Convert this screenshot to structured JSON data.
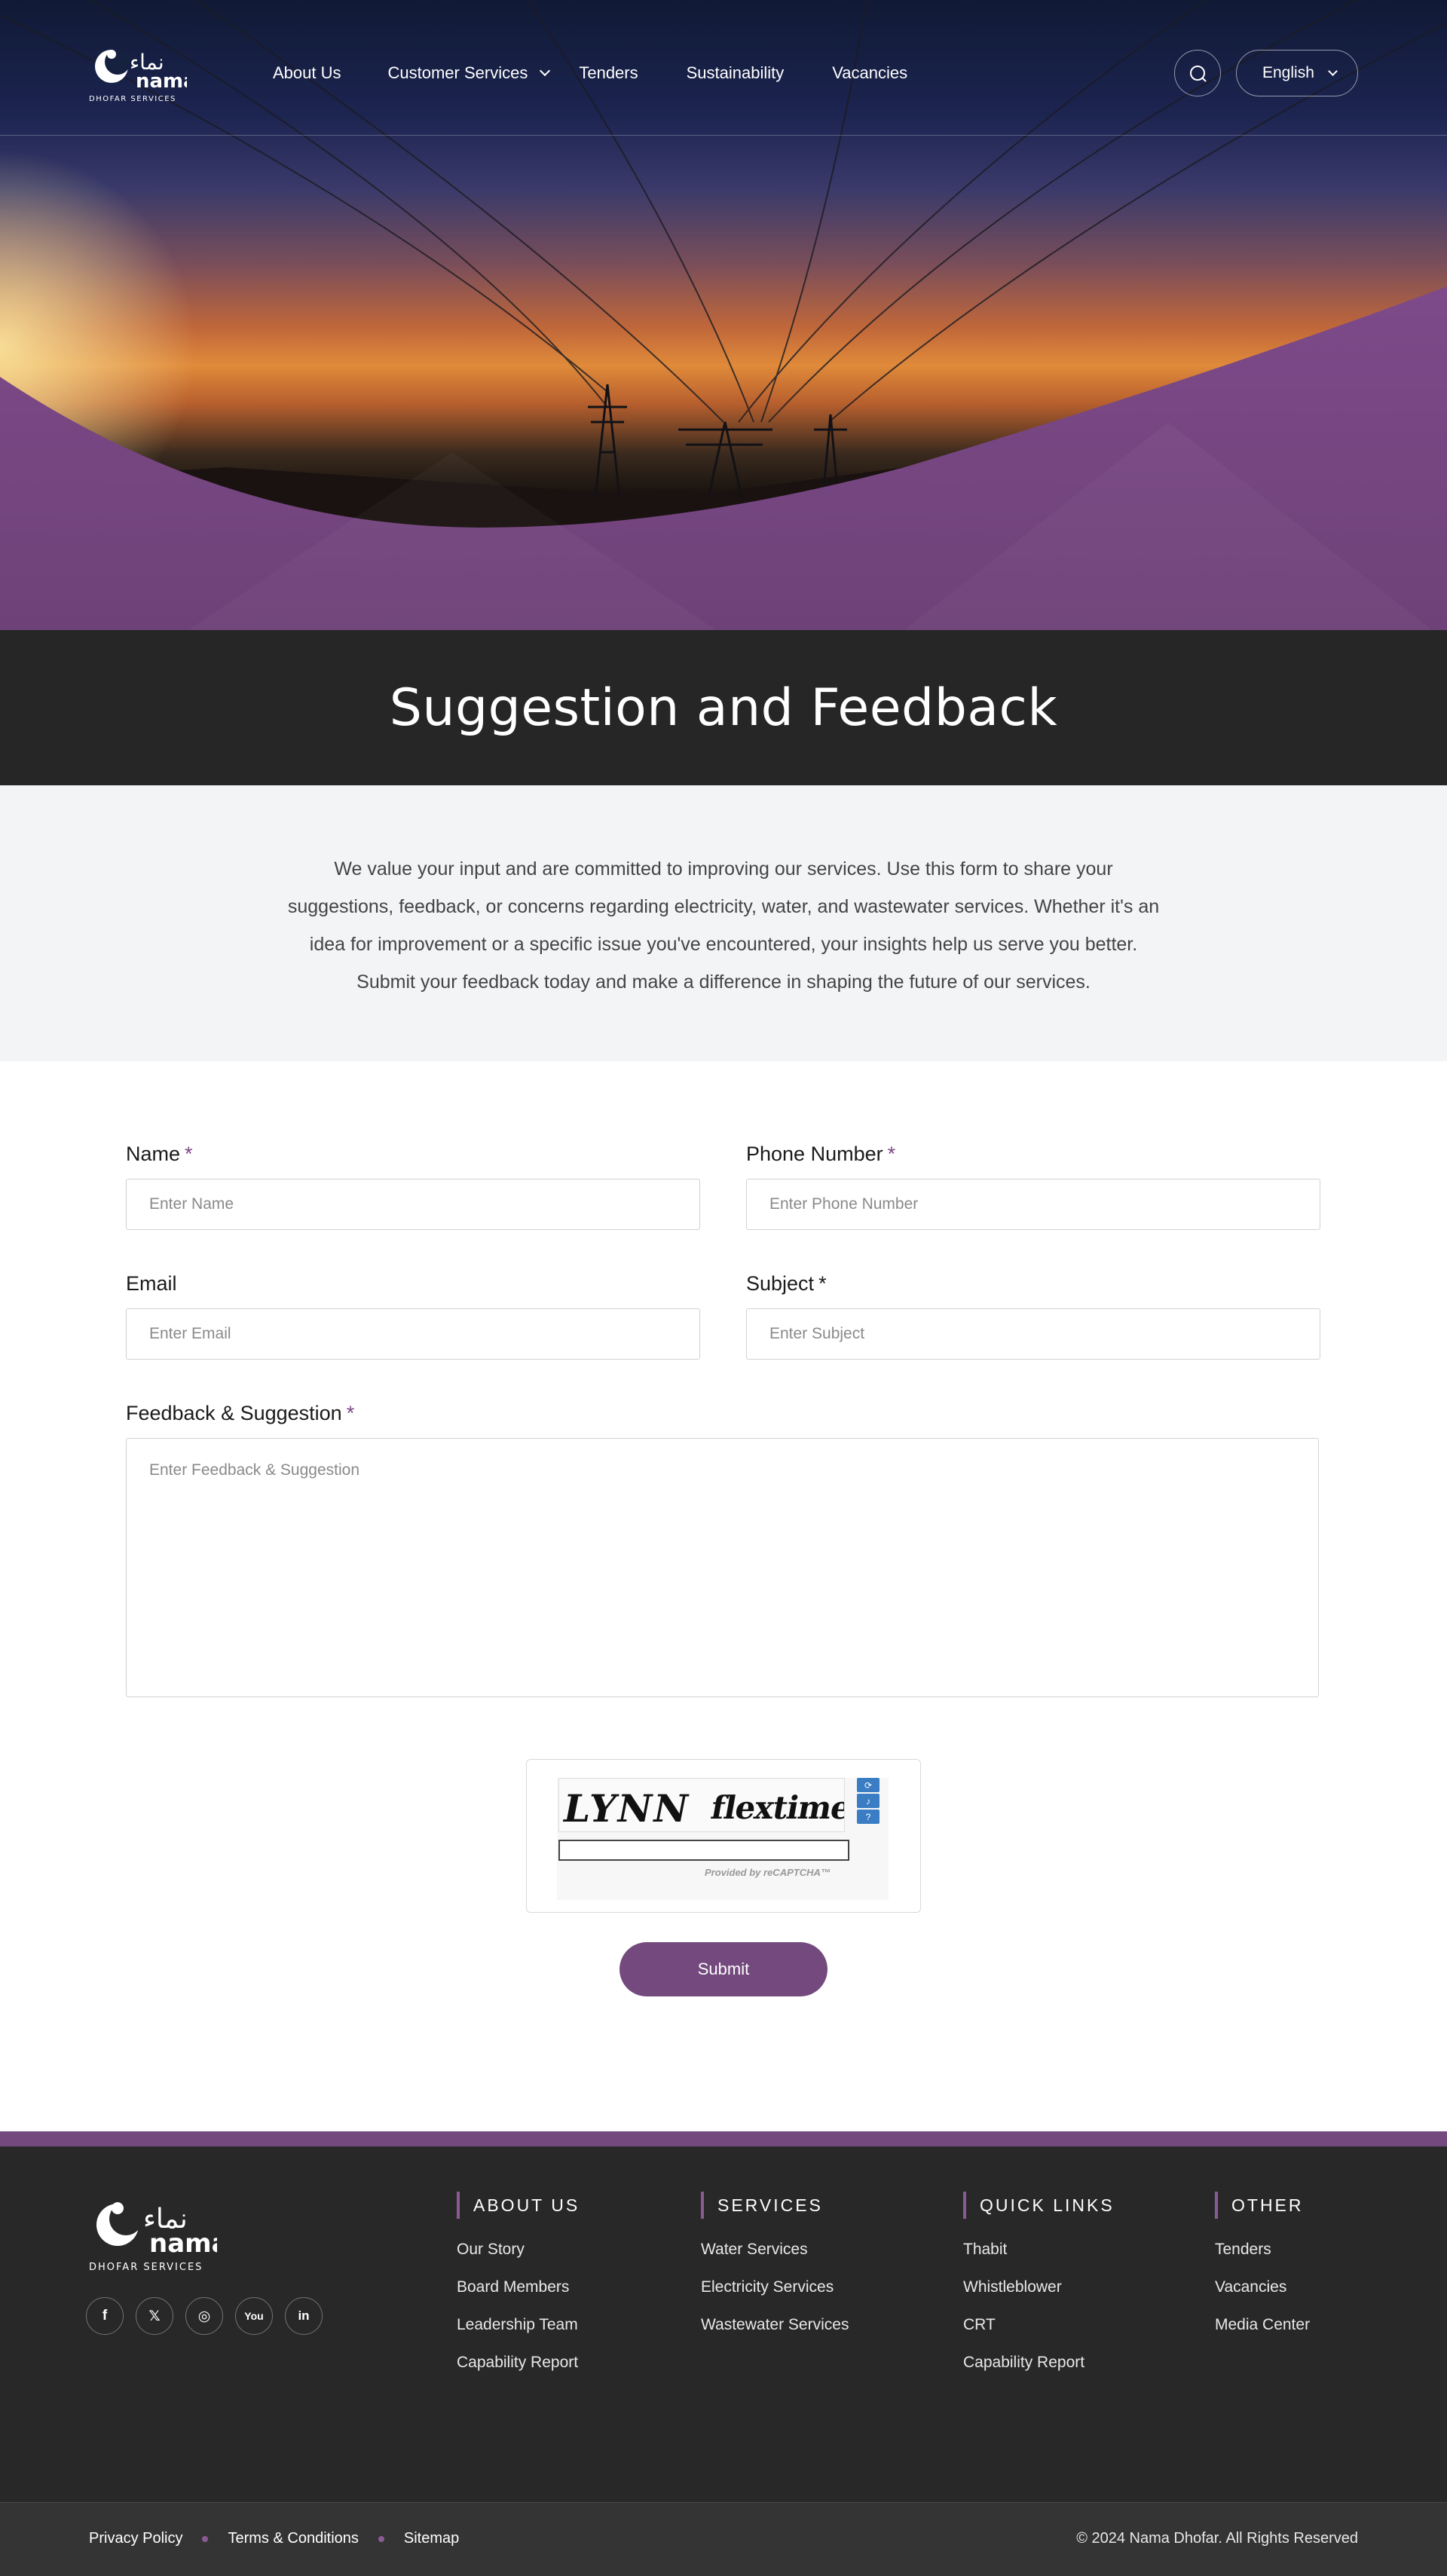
{
  "header": {
    "logo_arabic": "نماء",
    "logo_latin": "nama",
    "logo_sub": "DHOFAR SERVICES",
    "nav": [
      "About Us",
      "Customer Services",
      "Tenders",
      "Sustainability",
      "Vacancies"
    ],
    "language": "English"
  },
  "page": {
    "title": "Suggestion and Feedback",
    "intro": "We value your input and are committed to improving our services. Use this form to share your suggestions, feedback, or concerns regarding electricity, water, and wastewater services. Whether it's an idea for improvement or a specific issue you've encountered, your insights help us serve you better. Submit your feedback today and make a difference in shaping the future of our services."
  },
  "form": {
    "name": {
      "label": "Name",
      "required": "*",
      "placeholder": "Enter Name"
    },
    "phone": {
      "label": "Phone Number",
      "required": "*",
      "placeholder": "Enter Phone Number"
    },
    "email": {
      "label": "Email",
      "placeholder": "Enter Email"
    },
    "subject": {
      "label": "Subject",
      "required": "*",
      "placeholder": "Enter Subject"
    },
    "feedback": {
      "label": "Feedback & Suggestion",
      "required": "*",
      "placeholder": "Enter Feedback & Suggestion"
    },
    "captcha": {
      "word1": "LYNN",
      "word2": "flextime",
      "provider": "Provided by reCAPTCHA™"
    },
    "submit": "Submit"
  },
  "footer": {
    "columns": [
      {
        "title": "ABOUT US",
        "links": [
          "Our Story",
          "Board Members",
          "Leadership Team",
          "Capability Report"
        ]
      },
      {
        "title": "SERVICES",
        "links": [
          "Water Services",
          "Electricity Services",
          "Wastewater Services"
        ]
      },
      {
        "title": "QUICK LINKS",
        "links": [
          "Thabit",
          "Whistleblower",
          "CRT",
          "Capability Report"
        ]
      },
      {
        "title": "OTHER",
        "links": [
          "Tenders",
          "Vacancies",
          "Media Center"
        ]
      }
    ],
    "socials": [
      "facebook-icon",
      "x-icon",
      "instagram-icon",
      "youtube-icon",
      "linkedin-icon"
    ],
    "bottom_links": [
      "Privacy Policy",
      "Terms & Conditions",
      "Sitemap"
    ],
    "copyright": "© 2024 Nama Dhofar. All Rights Reserved"
  },
  "colors": {
    "brand_purple": "#744a7e",
    "dark": "#262626",
    "hero_sky": "#1c2450"
  }
}
